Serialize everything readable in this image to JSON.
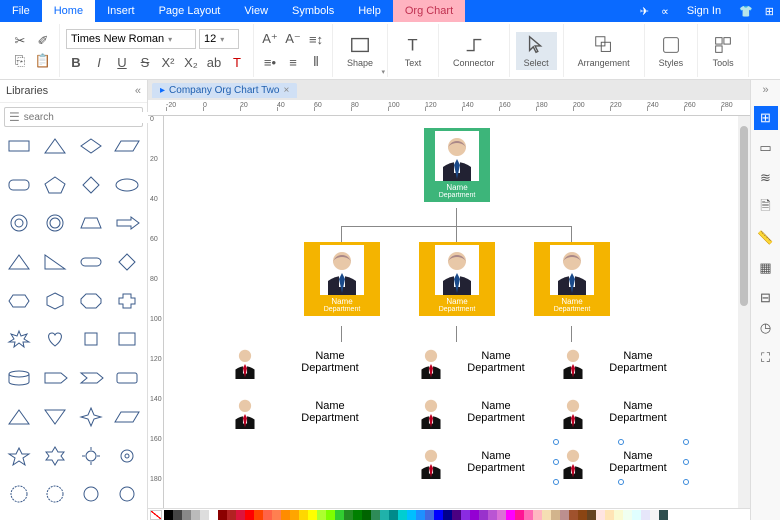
{
  "menu": {
    "file": "File",
    "home": "Home",
    "insert": "Insert",
    "page_layout": "Page Layout",
    "view": "View",
    "symbols": "Symbols",
    "help": "Help",
    "org_chart": "Org Chart",
    "sign_in": "Sign In"
  },
  "ribbon": {
    "font": "Times New Roman",
    "size": "12",
    "groups": {
      "shape": "Shape",
      "text": "Text",
      "connector": "Connector",
      "select": "Select",
      "arrangement": "Arrangement",
      "styles": "Styles",
      "tools": "Tools"
    }
  },
  "left": {
    "libraries": "Libraries",
    "search_placeholder": "search"
  },
  "tab": {
    "label": "Company Org Chart Two"
  },
  "ruler": {
    "h": [
      "-20",
      "0",
      "20",
      "40",
      "60",
      "80",
      "100",
      "120",
      "140",
      "160",
      "180",
      "200",
      "220",
      "240",
      "260",
      "280"
    ],
    "v": [
      "0",
      "20",
      "40",
      "60",
      "80",
      "100",
      "120",
      "140",
      "160",
      "180"
    ]
  },
  "org": {
    "root": {
      "name": "Name",
      "dept": "Department"
    },
    "level2": [
      {
        "name": "Name",
        "dept": "Department"
      },
      {
        "name": "Name",
        "dept": "Department"
      },
      {
        "name": "Name",
        "dept": "Department"
      }
    ],
    "level3": {
      "col1": [
        {
          "name": "Name",
          "dept": "Department"
        },
        {
          "name": "Name",
          "dept": "Department"
        }
      ],
      "col2": [
        {
          "name": "Name",
          "dept": "Department"
        },
        {
          "name": "Name",
          "dept": "Department"
        },
        {
          "name": "Name",
          "dept": "Department"
        }
      ],
      "col3": [
        {
          "name": "Name",
          "dept": "Department"
        },
        {
          "name": "Name",
          "dept": "Department"
        },
        {
          "name": "Name",
          "dept": "Department"
        }
      ]
    }
  },
  "colors": {
    "swatches": [
      "#000",
      "#444",
      "#888",
      "#bbb",
      "#ddd",
      "#fff",
      "#8b0000",
      "#b22222",
      "#dc143c",
      "#ff0000",
      "#ff4500",
      "#ff6347",
      "#ff7f50",
      "#ff8c00",
      "#ffa500",
      "#ffd700",
      "#ffff00",
      "#adff2f",
      "#7fff00",
      "#32cd32",
      "#228b22",
      "#008000",
      "#006400",
      "#2e8b57",
      "#20b2aa",
      "#008b8b",
      "#00ced1",
      "#00bfff",
      "#1e90ff",
      "#4169e1",
      "#0000ff",
      "#00008b",
      "#4b0082",
      "#8a2be2",
      "#9400d3",
      "#9932cc",
      "#ba55d3",
      "#da70d6",
      "#ff00ff",
      "#ff1493",
      "#ff69b4",
      "#ffb6c1",
      "#f5deb3",
      "#d2b48c",
      "#bc8f8f",
      "#a0522d",
      "#8b4513",
      "#654321",
      "#ffe4e1",
      "#ffe4b5",
      "#fafad2",
      "#f0fff0",
      "#e0ffff",
      "#e6e6fa",
      "#f5f5f5",
      "#2f4f4f"
    ]
  }
}
